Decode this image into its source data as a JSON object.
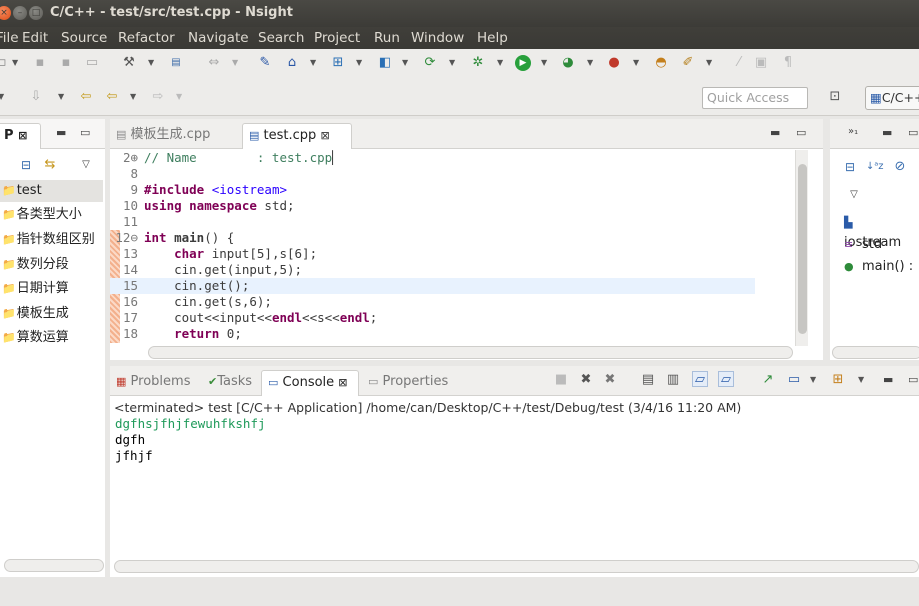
{
  "window": {
    "title": "C/C++ - test/src/test.cpp - Nsight"
  },
  "menu": [
    "File",
    "Edit",
    "Source",
    "Refactor",
    "Navigate",
    "Search",
    "Project",
    "Run",
    "Window",
    "Help"
  ],
  "quick_access": {
    "placeholder": "Quick Access"
  },
  "perspective": {
    "label": "C/C++"
  },
  "project_explorer": {
    "tab_label": "P",
    "items": [
      "test",
      "各类型大小",
      "指针数组区别",
      "数列分段",
      "日期计算",
      "模板生成",
      "算数运算"
    ],
    "selected": "test"
  },
  "editor": {
    "tabs": [
      "模板生成.cpp",
      "test.cpp"
    ],
    "active_tab": "test.cpp",
    "lines": [
      {
        "n": "2",
        "fold": "⊕",
        "text": "// Name        : test.cpp"
      },
      {
        "n": "8",
        "text": ""
      },
      {
        "n": "9",
        "text": "#include <iostream>"
      },
      {
        "n": "10",
        "text": "using namespace std;"
      },
      {
        "n": "11",
        "text": ""
      },
      {
        "n": "12",
        "fold": "⊖",
        "text": "int main() {"
      },
      {
        "n": "13",
        "text": "    char input[5],s[6];"
      },
      {
        "n": "14",
        "text": "    cin.get(input,5);"
      },
      {
        "n": "15",
        "text": "    cin.get();"
      },
      {
        "n": "16",
        "text": "    cin.get(s,6);"
      },
      {
        "n": "17",
        "text": "    cout<<input<<endl<<s<<endl;"
      },
      {
        "n": "18",
        "text": "    return 0;"
      }
    ]
  },
  "outline": {
    "items": [
      {
        "label": "iostream",
        "icon": "include-icon"
      },
      {
        "label": "std",
        "icon": "namespace-icon"
      },
      {
        "label": "main() :",
        "icon": "function-icon"
      }
    ]
  },
  "bottom_panel": {
    "tabs": [
      "Problems",
      "Tasks",
      "Console",
      "Properties"
    ],
    "active_tab": "Console",
    "status_line": "<terminated> test [C/C++ Application] /home/can/Desktop/C++/test/Debug/test (3/4/16 11:20 AM)",
    "output": [
      "dgfhsjfhjfewuhfkshfj",
      "dgfh",
      "jfhjf"
    ],
    "colors": {
      "input_text": "#1f9a5a",
      "output_text": "#000000"
    }
  }
}
